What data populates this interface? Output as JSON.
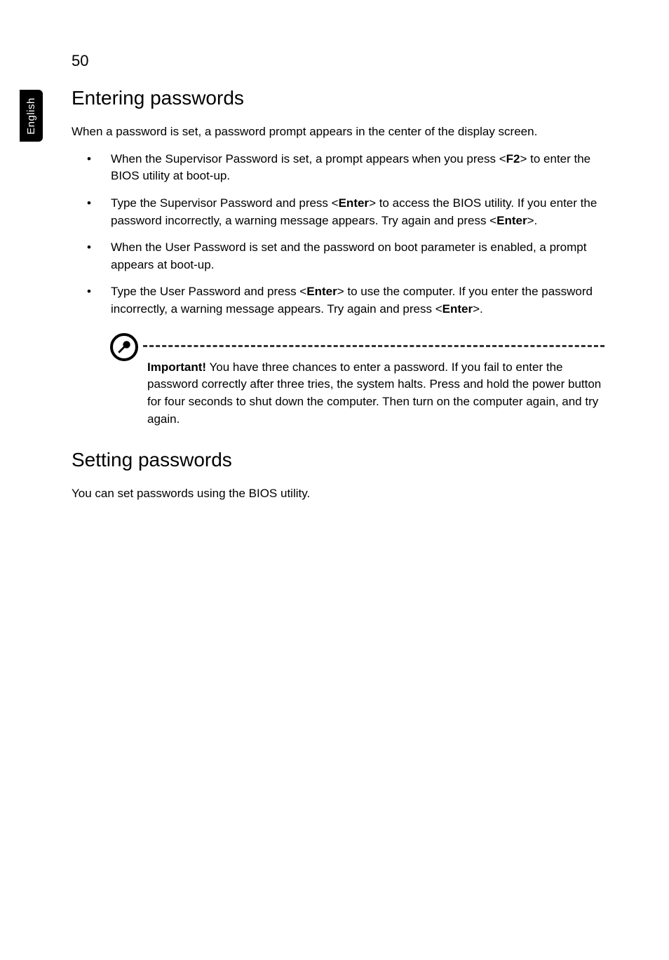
{
  "page_number": "50",
  "side_tab": "English",
  "h_entering": "Entering passwords",
  "intro": "When a password is set, a password prompt appears in the center of the display screen.",
  "b1_a": "When the Supervisor Password is set, a prompt appears when you press <",
  "b1_key": "F2",
  "b1_b": "> to enter the BIOS utility at boot-up.",
  "b2_a": "Type the Supervisor Password and press <",
  "b2_key1": "Enter",
  "b2_b": "> to access the BIOS utility. If you enter the password incorrectly, a warning message appears. Try again and press <",
  "b2_key2": "Enter",
  "b2_c": ">.",
  "b3": "When the User Password is set and the password on boot parameter is enabled, a prompt appears at boot-up.",
  "b4_a": "Type the User Password and press <",
  "b4_key1": "Enter",
  "b4_b": "> to use the computer. If you enter the password incorrectly, a warning message appears. Try again and press <",
  "b4_key2": "Enter",
  "b4_c": ">.",
  "note_label": "Important!",
  "note_body": " You have three chances to enter a password. If you fail to enter the password correctly after three tries, the system halts. Press and hold the power button for four seconds to shut down the computer. Then turn on the computer again, and try again.",
  "h_setting": "Setting passwords",
  "setting_body": "You can set passwords using the BIOS utility."
}
